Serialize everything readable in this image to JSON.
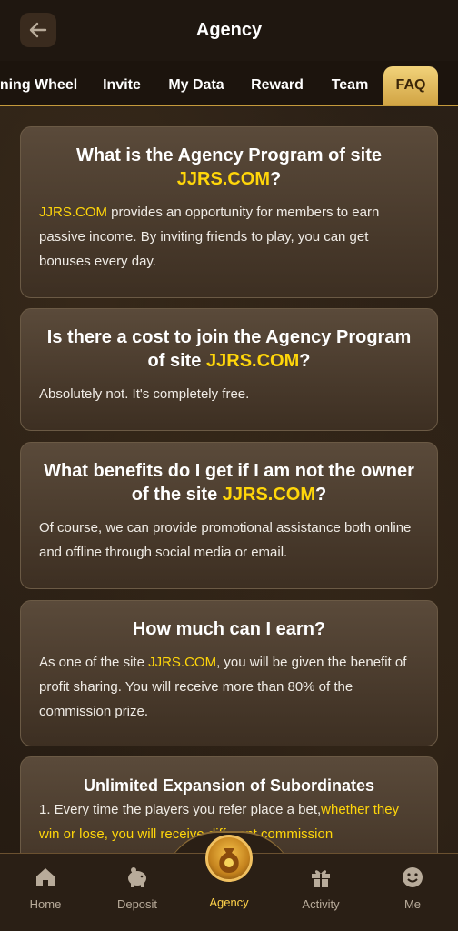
{
  "header": {
    "title": "Agency"
  },
  "tabs": [
    {
      "label": "ning Wheel"
    },
    {
      "label": "Invite"
    },
    {
      "label": "My Data"
    },
    {
      "label": "Reward"
    },
    {
      "label": "Team"
    },
    {
      "label": "FAQ"
    }
  ],
  "faq": [
    {
      "title_pre": "What is the Agency Program of site",
      "title_site": "JJRS.COM",
      "title_post": "?",
      "body_site": "JJRS.COM",
      "body": " provides an opportunity for members to earn passive income. By inviting friends to play, you can get bonuses every day."
    },
    {
      "title_pre": "Is there a cost to join the Agency Program of site",
      "title_site": "JJRS.COM",
      "title_post": "?",
      "body": "Absolutely not. It's completely free."
    },
    {
      "title_pre": "What benefits do I get if I am not the owner of the site",
      "title_site": "JJRS.COM",
      "title_post": "?",
      "body": "Of course, we can provide promotional assistance both online and offline through social media or email."
    },
    {
      "title": "How much can I earn?",
      "body_pre": "As one of the site ",
      "body_site": "JJRS.COM",
      "body_post": ", you will be given the benefit of profit sharing. You will receive more than 80% of the commission prize."
    },
    {
      "title": "Unlimited Expansion of Subordinates",
      "body_pre": "1. Every time the players you refer place a bet,",
      "body_highlight": "whether they win or lose, you will receive different commission"
    }
  ],
  "bottom_nav": [
    {
      "label": "Home",
      "icon": "home-icon"
    },
    {
      "label": "Deposit",
      "icon": "piggy-bank-icon"
    },
    {
      "label": "Agency",
      "icon": "money-bag-icon"
    },
    {
      "label": "Activity",
      "icon": "gift-icon"
    },
    {
      "label": "Me",
      "icon": "smiley-icon"
    }
  ],
  "colors": {
    "accent": "#ffd60a",
    "tab_active": "#e2b957",
    "bg": "#2a1f15"
  }
}
